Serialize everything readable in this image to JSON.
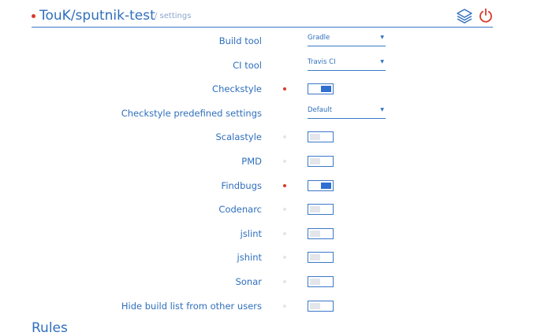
{
  "header": {
    "repo": "TouK/sputnik-test",
    "crumb": "/ settings",
    "icons": [
      "layers-icon",
      "power-icon"
    ]
  },
  "colors": {
    "accent": "#2f6fbd",
    "active_dot": "#d93a2b",
    "toggle_on": "#2e6fd1",
    "toggle_off": "#e3e6ea"
  },
  "settings": [
    {
      "label": "Build tool",
      "type": "select",
      "value": "Gradle"
    },
    {
      "label": "CI tool",
      "type": "select",
      "value": "Travis CI"
    },
    {
      "label": "Checkstyle",
      "type": "toggle",
      "on": true
    },
    {
      "label": "Checkstyle predefined settings",
      "type": "select",
      "value": "Default"
    },
    {
      "label": "Scalastyle",
      "type": "toggle",
      "on": false
    },
    {
      "label": "PMD",
      "type": "toggle",
      "on": false
    },
    {
      "label": "Findbugs",
      "type": "toggle",
      "on": true
    },
    {
      "label": "Codenarc",
      "type": "toggle",
      "on": false
    },
    {
      "label": "jslint",
      "type": "toggle",
      "on": false
    },
    {
      "label": "jshint",
      "type": "toggle",
      "on": false
    },
    {
      "label": "Sonar",
      "type": "toggle",
      "on": false
    },
    {
      "label": "Hide build list from other users",
      "type": "toggle",
      "on": false
    }
  ],
  "footer": {
    "heading": "Rules"
  }
}
